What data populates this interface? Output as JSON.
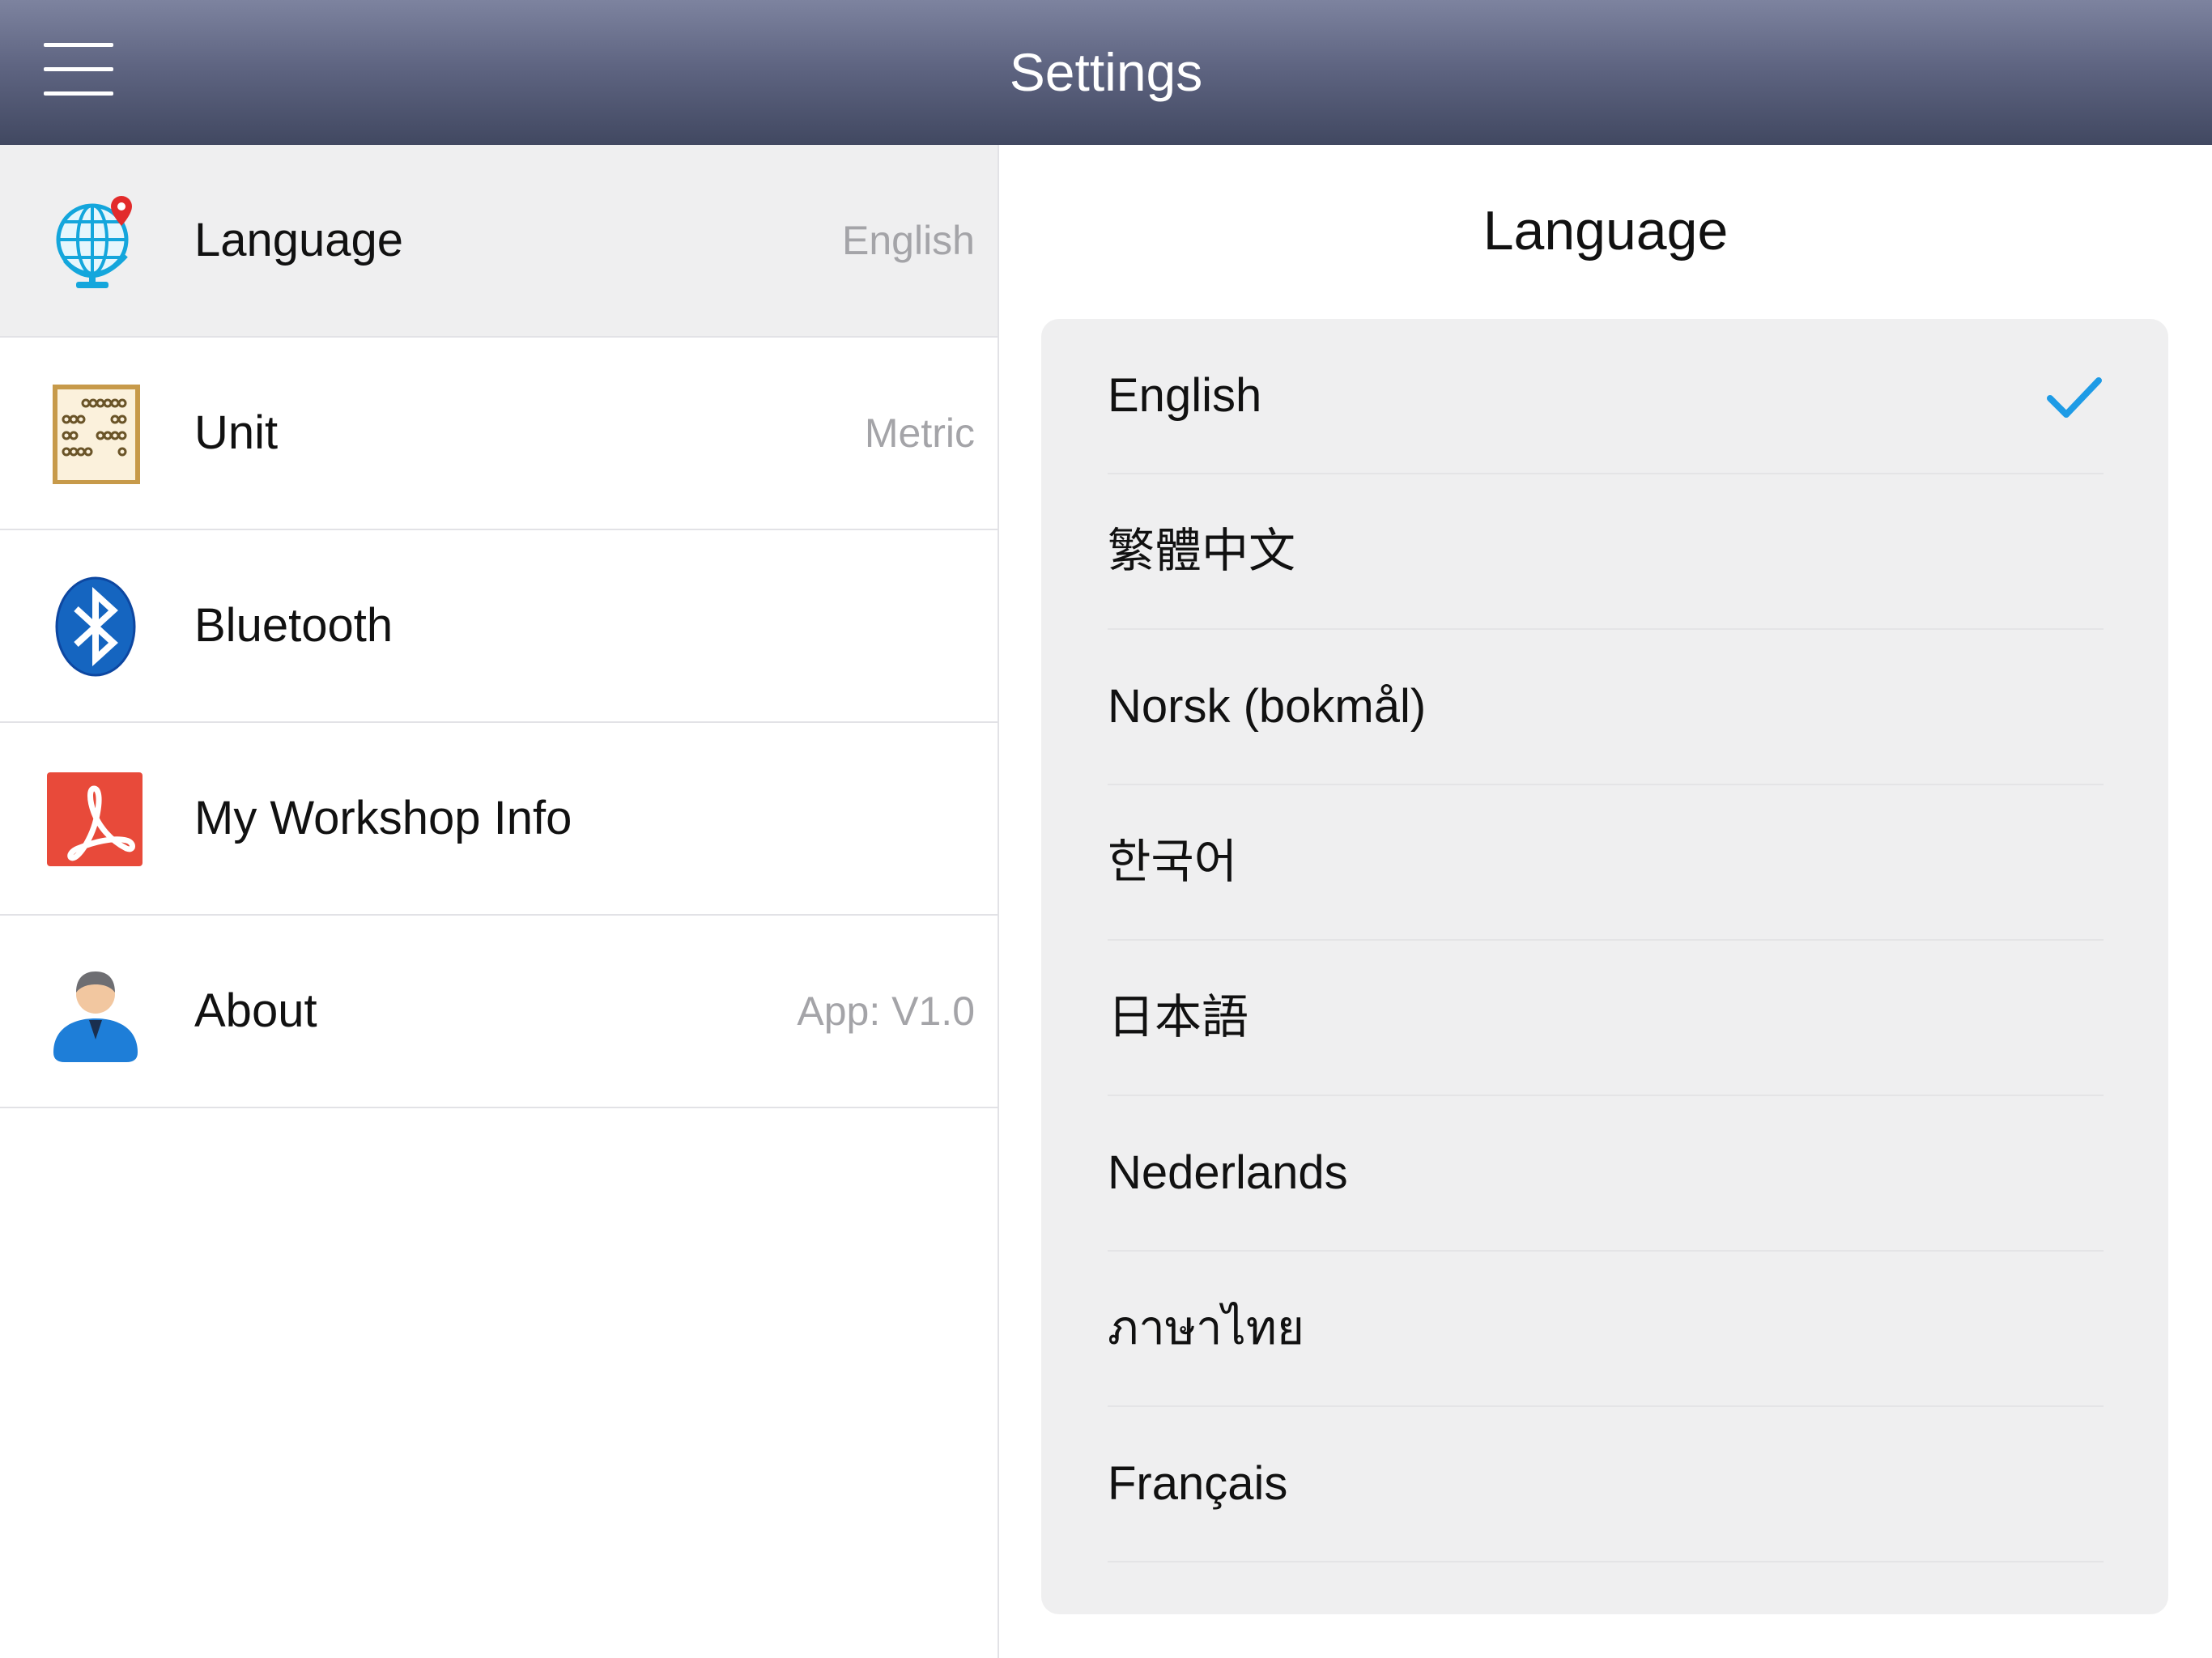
{
  "header": {
    "title": "Settings"
  },
  "sidebar": {
    "items": [
      {
        "label": "Language",
        "value": "English",
        "icon": "globe-icon",
        "selected": true
      },
      {
        "label": "Unit",
        "value": "Metric",
        "icon": "abacus-icon"
      },
      {
        "label": "Bluetooth",
        "value": "",
        "icon": "bluetooth-icon"
      },
      {
        "label": "My Workshop Info",
        "value": "",
        "icon": "pdf-icon"
      },
      {
        "label": "About",
        "value": "App: V1.0",
        "icon": "user-icon"
      }
    ]
  },
  "detail": {
    "title": "Language",
    "languages": [
      {
        "label": "English",
        "checked": true
      },
      {
        "label": "繁體中文"
      },
      {
        "label": "Norsk (bokmål)"
      },
      {
        "label": "한국어"
      },
      {
        "label": "日本語"
      },
      {
        "label": "Nederlands"
      },
      {
        "label": "ภาษาไทย"
      },
      {
        "label": "Français"
      }
    ]
  },
  "colors": {
    "navbar_top": "#7d839f",
    "navbar_bottom": "#414861",
    "accent_check": "#1e9be6",
    "selected_row": "#efeff0",
    "secondary_text": "#a4a4a8"
  }
}
